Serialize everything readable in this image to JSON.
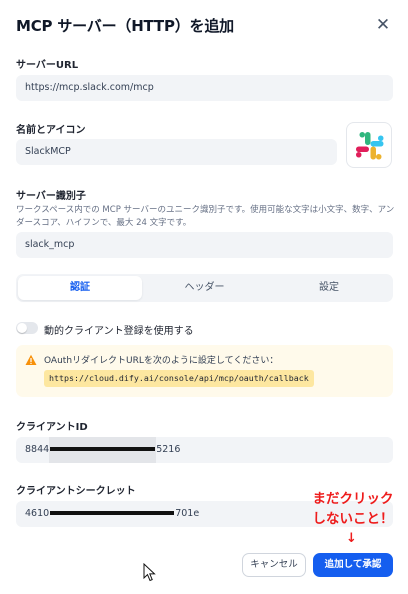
{
  "dialog": {
    "title": "MCP サーバー（HTTP）を追加",
    "close_icon": "close-icon"
  },
  "server_url": {
    "label": "サーバーURL",
    "value": "https://mcp.slack.com/mcp"
  },
  "name_icon": {
    "label": "名前とアイコン",
    "value": "SlackMCP",
    "icon": "slack-logo-icon"
  },
  "server_id": {
    "label": "サーバー識別子",
    "description": "ワークスペース内での MCP サーバーのユニーク識別子です。使用可能な文字は小文字、数字、アンダースコア、ハイフンで、最大 24 文字です。",
    "value": "slack_mcp"
  },
  "tabs": [
    {
      "label": "認証",
      "active": true
    },
    {
      "label": "ヘッダー",
      "active": false
    },
    {
      "label": "設定",
      "active": false
    }
  ],
  "dynamic_client": {
    "label": "動的クライアント登録を使用する",
    "enabled": false
  },
  "oauth_notice": {
    "icon": "warning-icon",
    "text": "OAuthリダイレクトURLを次のように設定してください：",
    "code": "https://cloud.dify.ai/console/api/mcp/oauth/callback"
  },
  "client_id": {
    "label": "クライアントID",
    "prefix": "8844",
    "suffix": "5216"
  },
  "client_secret": {
    "label": "クライアントシークレット",
    "prefix": "4610",
    "suffix": "701e"
  },
  "annotation": {
    "line1": "まだクリック",
    "line2": "しないこと！",
    "arrow": "↓"
  },
  "buttons": {
    "cancel": "キャンセル",
    "submit": "追加して承認"
  },
  "colors": {
    "primary": "#155eef",
    "warning_bg": "#fffaeb",
    "code_bg": "#fde7a0",
    "annotation": "#ee1c1c"
  }
}
